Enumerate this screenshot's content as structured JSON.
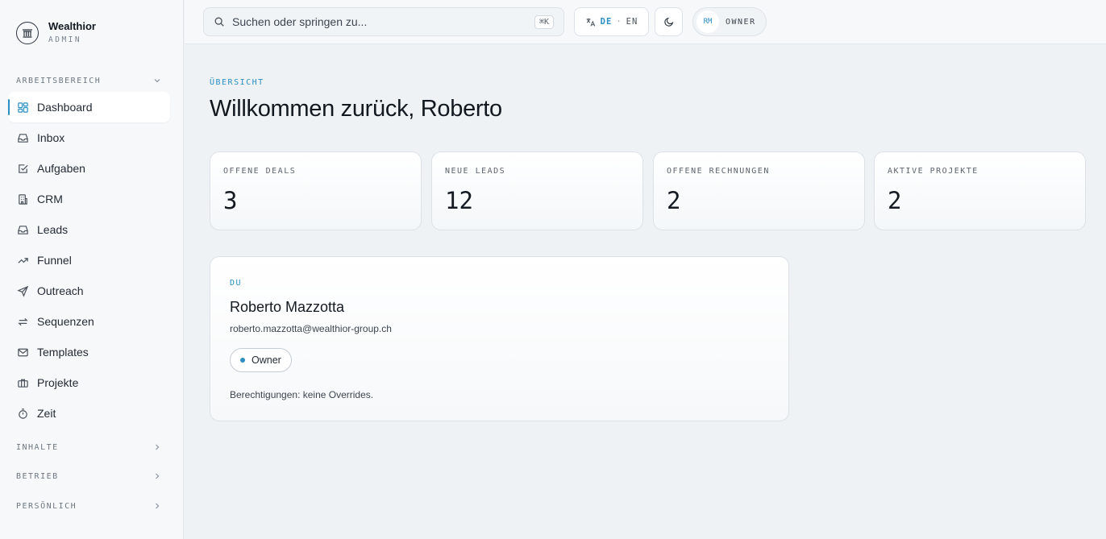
{
  "brand": {
    "name": "Wealthior",
    "sub": "ADMIN"
  },
  "sidebar": {
    "sections": {
      "workspace": "ARBEITSBEREICH",
      "content": "INHALTE",
      "operations": "BETRIEB",
      "personal": "PERSÖNLICH"
    },
    "items": [
      {
        "label": "Dashboard",
        "icon": "dashboard-icon"
      },
      {
        "label": "Inbox",
        "icon": "inbox-icon"
      },
      {
        "label": "Aufgaben",
        "icon": "checkbox-icon"
      },
      {
        "label": "CRM",
        "icon": "building-icon"
      },
      {
        "label": "Leads",
        "icon": "inbox-icon"
      },
      {
        "label": "Funnel",
        "icon": "trend-icon"
      },
      {
        "label": "Outreach",
        "icon": "send-icon"
      },
      {
        "label": "Sequenzen",
        "icon": "repeat-icon"
      },
      {
        "label": "Templates",
        "icon": "mail-icon"
      },
      {
        "label": "Projekte",
        "icon": "briefcase-icon"
      },
      {
        "label": "Zeit",
        "icon": "timer-icon"
      }
    ],
    "active": "Dashboard"
  },
  "topbar": {
    "search_placeholder": "Suchen oder springen zu...",
    "search_shortcut": "⌘K",
    "lang_active": "DE",
    "lang_separator": "·",
    "lang_other": "EN",
    "user_initials": "RM",
    "user_role": "OWNER"
  },
  "main": {
    "eyebrow": "ÜBERSICHT",
    "title": "Willkommen zurück, Roberto",
    "stats": [
      {
        "label": "OFFENE DEALS",
        "value": "3"
      },
      {
        "label": "NEUE LEADS",
        "value": "12"
      },
      {
        "label": "OFFENE RECHNUNGEN",
        "value": "2"
      },
      {
        "label": "AKTIVE PROJEKTE",
        "value": "2"
      }
    ],
    "profile": {
      "eyebrow": "DU",
      "name": "Roberto Mazzotta",
      "email": "roberto.mazzotta@wealthior-group.ch",
      "role": "Owner",
      "permissions": "Berechtigungen: keine Overrides."
    }
  },
  "colors": {
    "accent": "#2a8fc4",
    "background": "#eef2f5",
    "sidebar": "#f6f8fa"
  }
}
